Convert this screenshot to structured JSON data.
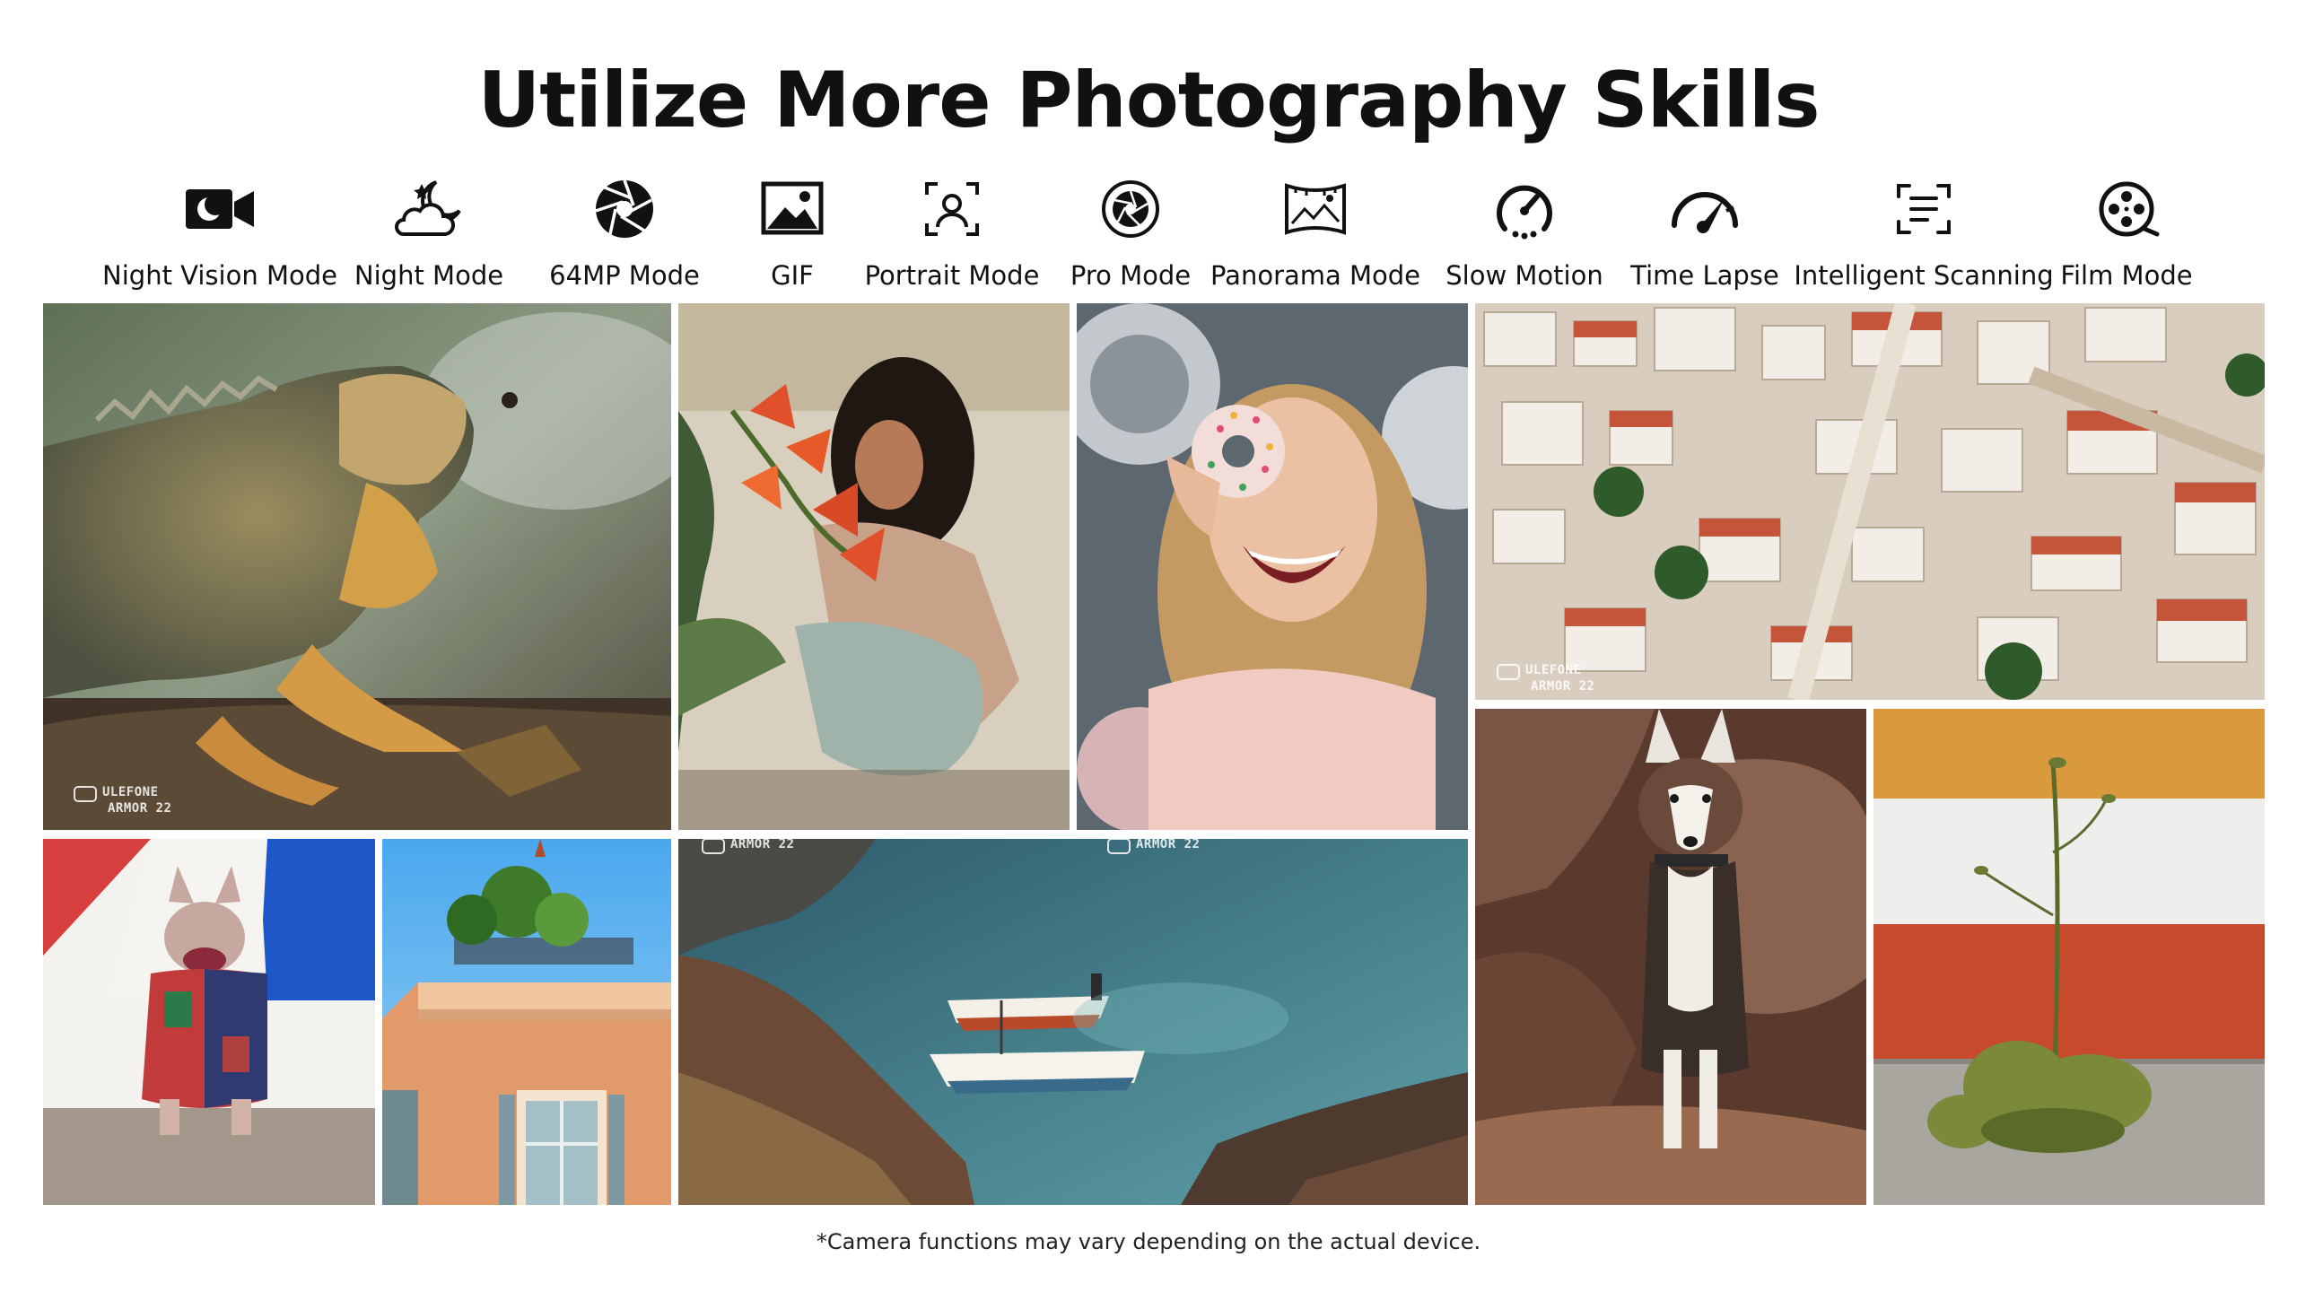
{
  "title": "Utilize More Photography Skills",
  "modes": [
    {
      "label": "Night Vision Mode",
      "icon": "night-vision-camera-icon"
    },
    {
      "label": "Night Mode",
      "icon": "moon-cloud-icon"
    },
    {
      "label": "64MP Mode",
      "icon": "aperture-icon"
    },
    {
      "label": "GIF",
      "icon": "image-icon"
    },
    {
      "label": "Portrait Mode",
      "icon": "portrait-frame-icon"
    },
    {
      "label": "Pro Mode",
      "icon": "shutter-icon"
    },
    {
      "label": "Panorama Mode",
      "icon": "panorama-icon"
    },
    {
      "label": "Slow Motion",
      "icon": "slow-motion-dial-icon"
    },
    {
      "label": "Time Lapse",
      "icon": "speed-gauge-icon"
    },
    {
      "label": "Intelligent Scanning",
      "icon": "scan-frame-icon"
    },
    {
      "label": "Film Mode",
      "icon": "film-reel-icon"
    }
  ],
  "watermark": {
    "line1": "ULEFONE",
    "line2": "ARMOR 22"
  },
  "footnote": "*Camera functions may vary depending on the actual device."
}
